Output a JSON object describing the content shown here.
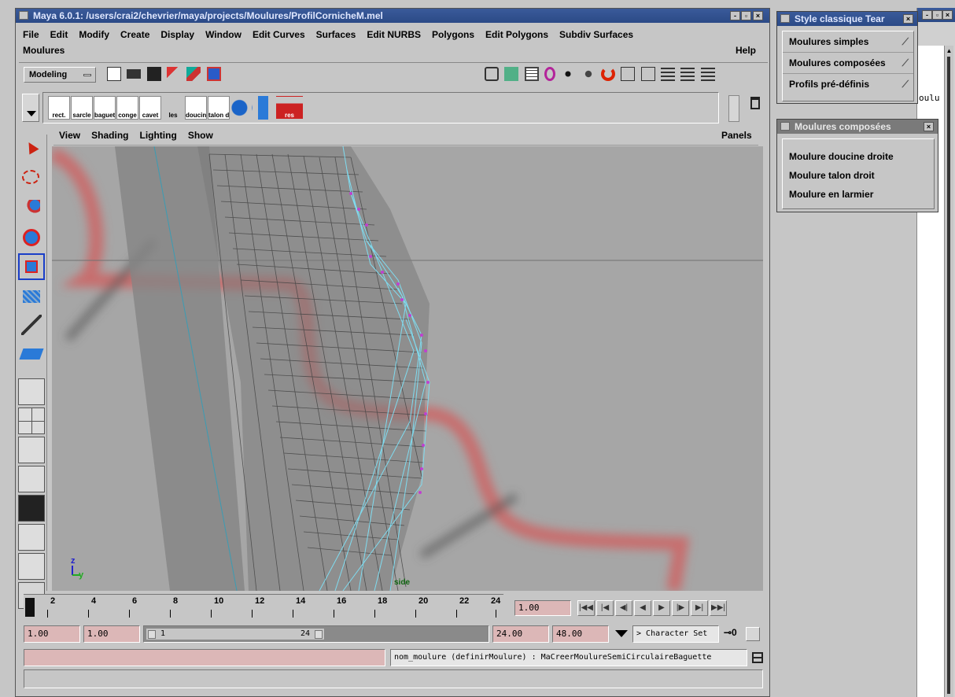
{
  "window": {
    "title": "Maya 6.0.1: /users/crai2/chevrier/maya/projects/Moulures/ProfilCornicheM.mel",
    "menu": [
      "File",
      "Edit",
      "Modify",
      "Create",
      "Display",
      "Window",
      "Edit Curves",
      "Surfaces",
      "Edit NURBS",
      "Polygons",
      "Edit Polygons",
      "Subdiv Surfaces"
    ],
    "menu2": "Moulures",
    "help": "Help"
  },
  "statusline": {
    "mode": "Modeling"
  },
  "shelf": {
    "items": [
      "rect.",
      "sarcle",
      "baguet",
      "conge",
      "cavet",
      "les",
      "doucin",
      "talon d",
      "",
      "",
      "res"
    ]
  },
  "panel": {
    "menus": [
      "View",
      "Shading",
      "Lighting",
      "Show"
    ],
    "panels_label": "Panels",
    "camera_label": "side",
    "axis_z": "z",
    "axis_y": "y"
  },
  "timeline": {
    "ticks": [
      "2",
      "4",
      "6",
      "8",
      "10",
      "12",
      "14",
      "16",
      "18",
      "20",
      "22",
      "24"
    ],
    "current_frame": "1.00"
  },
  "range": {
    "start": "1.00",
    "playback_start": "1.00",
    "slider_min": "1",
    "slider_max": "24",
    "playback_end": "24.00",
    "end": "48.00",
    "character_set": "Character Set"
  },
  "command": {
    "input": "",
    "result": "nom_moulure (definirMoulure) : MaCreerMoulureSemiCirculaireBaguette"
  },
  "float1": {
    "title": "Style classique Tear",
    "items": [
      "Moulures simples",
      "Moulures composées",
      "Profils pré-définis"
    ]
  },
  "float2": {
    "title": "Moulures composées",
    "items": [
      "Moulure doucine droite",
      "Moulure talon droit",
      "Moulure en larmier"
    ]
  },
  "bg_window": {
    "fragment": "oulu"
  }
}
